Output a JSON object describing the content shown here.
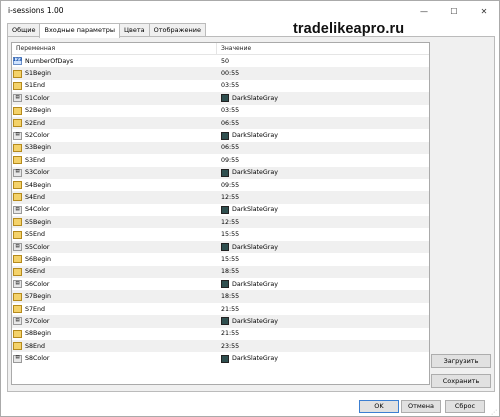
{
  "window": {
    "title": "i-sessions 1.00"
  },
  "brand": "tradelikeapro.ru",
  "tabs": [
    "Общие",
    "Входные параметры",
    "Цвета",
    "Отображение"
  ],
  "grid": {
    "headers": [
      "Переменная",
      "Значение"
    ],
    "rows": [
      {
        "name": "NumberOfDays",
        "value": "50",
        "icon": "int-icon"
      },
      {
        "name": "S1Begin",
        "value": "00:55",
        "icon": "string-icon"
      },
      {
        "name": "S1End",
        "value": "03:55",
        "icon": "string-icon"
      },
      {
        "name": "S1Color",
        "value": "DarkSlateGray",
        "icon": "color-icon"
      },
      {
        "name": "S2Begin",
        "value": "03:55",
        "icon": "string-icon"
      },
      {
        "name": "S2End",
        "value": "06:55",
        "icon": "string-icon"
      },
      {
        "name": "S2Color",
        "value": "DarkSlateGray",
        "icon": "color-icon"
      },
      {
        "name": "S3Begin",
        "value": "06:55",
        "icon": "string-icon"
      },
      {
        "name": "S3End",
        "value": "09:55",
        "icon": "string-icon"
      },
      {
        "name": "S3Color",
        "value": "DarkSlateGray",
        "icon": "color-icon"
      },
      {
        "name": "S4Begin",
        "value": "09:55",
        "icon": "string-icon"
      },
      {
        "name": "S4End",
        "value": "12:55",
        "icon": "string-icon"
      },
      {
        "name": "S4Color",
        "value": "DarkSlateGray",
        "icon": "color-icon"
      },
      {
        "name": "S5Begin",
        "value": "12:55",
        "icon": "string-icon"
      },
      {
        "name": "S5End",
        "value": "15:55",
        "icon": "string-icon"
      },
      {
        "name": "S5Color",
        "value": "DarkSlateGray",
        "icon": "color-icon"
      },
      {
        "name": "S6Begin",
        "value": "15:55",
        "icon": "string-icon"
      },
      {
        "name": "S6End",
        "value": "18:55",
        "icon": "string-icon"
      },
      {
        "name": "S6Color",
        "value": "DarkSlateGray",
        "icon": "color-icon"
      },
      {
        "name": "S7Begin",
        "value": "18:55",
        "icon": "string-icon"
      },
      {
        "name": "S7End",
        "value": "21:55",
        "icon": "string-icon"
      },
      {
        "name": "S7Color",
        "value": "DarkSlateGray",
        "icon": "color-icon"
      },
      {
        "name": "S8Begin",
        "value": "21:55",
        "icon": "string-icon"
      },
      {
        "name": "S8End",
        "value": "23:55",
        "icon": "string-icon"
      },
      {
        "name": "S8Color",
        "value": "DarkSlateGray",
        "icon": "color-icon"
      }
    ]
  },
  "buttons": {
    "load": "Загрузить",
    "save": "Сохранить",
    "ok": "OK",
    "cancel": "Отмена",
    "reset": "Сброс"
  },
  "colors": {
    "swatch": "#2F4F4F",
    "active_accent": "#3C7FD1"
  }
}
